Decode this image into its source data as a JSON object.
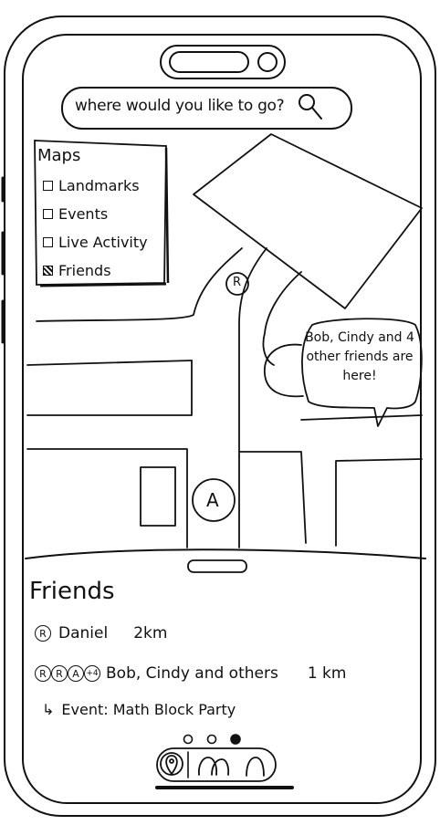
{
  "search": {
    "placeholder": "where would you like to go?",
    "icon": "search-icon"
  },
  "layers_panel": {
    "title": "Maps",
    "items": [
      {
        "label": "Landmarks",
        "checked": false
      },
      {
        "label": "Events",
        "checked": false
      },
      {
        "label": "Live Activity",
        "checked": false
      },
      {
        "label": "Friends",
        "checked": true
      }
    ]
  },
  "map": {
    "pins": [
      {
        "initial": "R"
      },
      {
        "initial": "A"
      }
    ],
    "callout": "Bob, Cindy and 4 other friends are here!"
  },
  "friends_sheet": {
    "title": "Friends",
    "rows": [
      {
        "avatars": [
          "R"
        ],
        "name": "Daniel",
        "distance": "2km"
      },
      {
        "avatars": [
          "R",
          "R",
          "A",
          "+4"
        ],
        "name": "Bob, Cindy and others",
        "distance": "1 km"
      },
      {
        "prefix": "↳",
        "name": "Event: Math Block Party"
      }
    ]
  },
  "page_indicator": {
    "count": 3,
    "active_index": 2
  },
  "tab_bar": {
    "items": [
      "map-pin-icon",
      "people-icon",
      "person-icon"
    ]
  }
}
